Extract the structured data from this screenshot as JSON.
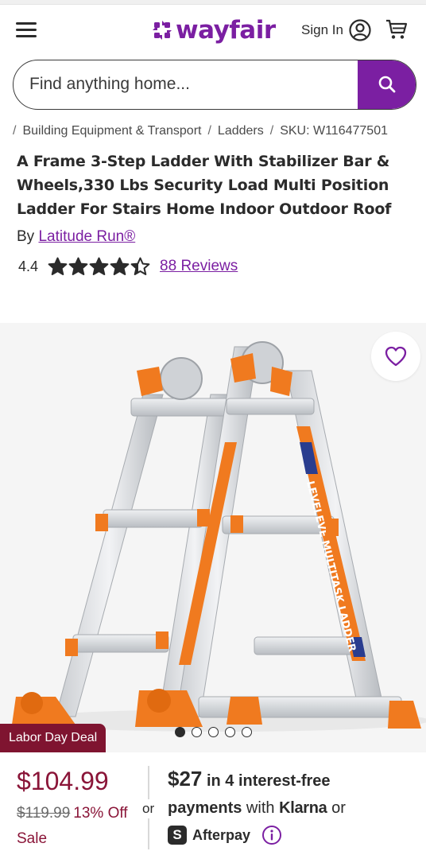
{
  "header": {
    "logo_text": "wayfair",
    "signin_label": "Sign In",
    "brand_color": "#7b1fa2"
  },
  "search": {
    "placeholder": "Find anything home...",
    "value": ""
  },
  "breadcrumb": {
    "items": [
      "Building Equipment & Transport",
      "Ladders",
      "SKU: W116477501"
    ]
  },
  "product": {
    "title": "A Frame 3-Step Ladder With Stabilizer Bar & Wheels,330 Lbs Security Load Multi Position Ladder For Stairs Home Indoor Outdoor Roof",
    "by_label": "By",
    "brand": "Latitude Run®",
    "rating": "4.4",
    "rating_numeric": 4.4,
    "reviews_label": "88 Reviews"
  },
  "gallery": {
    "ladder_text": "LEVELEVE MULTITASK LADDER",
    "image_count": 5,
    "active_index": 0
  },
  "deal": {
    "badge": "Labor Day Deal",
    "badge_color": "#7f1430"
  },
  "pricing": {
    "price": "$104.99",
    "old_price": "$119.99",
    "percent_off": "13% Off",
    "sale_label": "Sale",
    "or_label": "or",
    "sale_color": "#8a1538"
  },
  "financing": {
    "amount": "$27",
    "line1_rest": " in 4 interest-free",
    "payments_label": "payments",
    "with_label": " with ",
    "klarna": "Klarna",
    "or_label": " or",
    "afterpay_glyph": "S",
    "afterpay": "Afterpay"
  },
  "icons": {
    "menu": "hamburger-menu-icon",
    "account": "account-circle-icon",
    "cart": "shopping-cart-icon",
    "search": "search-icon",
    "favorite": "heart-icon",
    "info": "info-icon",
    "star": "star-icon"
  }
}
